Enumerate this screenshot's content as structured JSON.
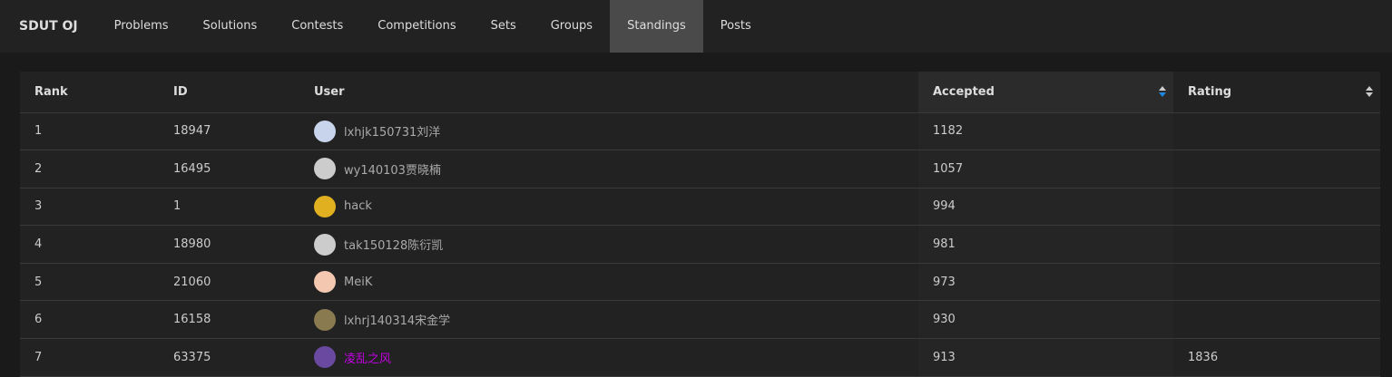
{
  "nav": {
    "brand": "SDUT OJ",
    "items": [
      "Problems",
      "Solutions",
      "Contests",
      "Competitions",
      "Sets",
      "Groups",
      "Standings",
      "Posts"
    ],
    "active": "Standings"
  },
  "table": {
    "headers": {
      "rank": "Rank",
      "id": "ID",
      "user": "User",
      "accepted": "Accepted",
      "rating": "Rating"
    },
    "sorted_by": "Accepted",
    "sort_direction": "descending",
    "accent": "#1e88e5",
    "rows": [
      {
        "rank": "1",
        "id": "18947",
        "user": "lxhjk150731刘洋",
        "accepted": "1182",
        "rating": "",
        "avatar": "#c8d4ec"
      },
      {
        "rank": "2",
        "id": "16495",
        "user": "wy140103贾晓楠",
        "accepted": "1057",
        "rating": "",
        "avatar": "#cccccc"
      },
      {
        "rank": "3",
        "id": "1",
        "user": "hack",
        "accepted": "994",
        "rating": "",
        "avatar": "#e0b020"
      },
      {
        "rank": "4",
        "id": "18980",
        "user": "tak150128陈衍凯",
        "accepted": "981",
        "rating": "",
        "avatar": "#cccccc"
      },
      {
        "rank": "5",
        "id": "21060",
        "user": "MeiK",
        "accepted": "973",
        "rating": "",
        "avatar": "#f4c8b0"
      },
      {
        "rank": "6",
        "id": "16158",
        "user": "lxhrj140314宋金学",
        "accepted": "930",
        "rating": "",
        "avatar": "#8a7a50"
      },
      {
        "rank": "7",
        "id": "63375",
        "user": "凌乱之风",
        "accepted": "913",
        "rating": "1836",
        "avatar": "#6a4aa0",
        "user_color": "#c000e0"
      }
    ]
  }
}
